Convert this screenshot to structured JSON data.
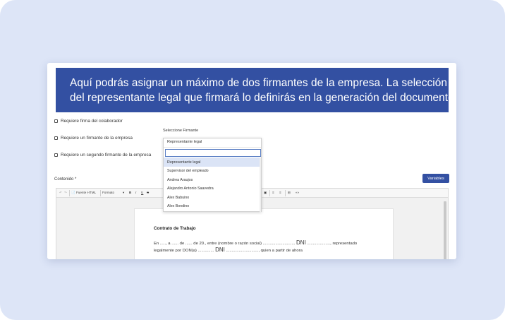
{
  "banner": {
    "line1": "Aquí podrás asignar un máximo de dos firmantes de la empresa. La selección",
    "line2": "del representante legal que firmará lo definirás en la generación del documento."
  },
  "checkboxes": [
    {
      "label": "Requiere firma del colaborador"
    },
    {
      "label": "Requiere un firmante de la empresa"
    },
    {
      "label": "Requiere un segundo firmante de la empresa"
    }
  ],
  "select_firmante": {
    "label": "Seleccione Firmante",
    "selected": "Representante legal",
    "search_value": "",
    "options": [
      "Representante legal",
      "Supervisor del empleado",
      "Andrea Araujos",
      "Alejandro Antonio Saavedra",
      "Alex Babuino",
      "Alex Bondino"
    ]
  },
  "editor": {
    "label": "Contenido *",
    "variables_button": "Variables",
    "toolbar": {
      "source": "Fuente HTML",
      "format": "Formato",
      "bold": "B",
      "italic": "I",
      "underline": "U",
      "strike": "S"
    },
    "document": {
      "title": "Contrato de Trabajo",
      "line1_a": "En ....., a ...... de ...... de 20., entre (nombre o razón social) ............................",
      "dni1": "DNI",
      "line1_b": "...................., representado",
      "line2_a": "legalmente por DON(a) ..............",
      "dni2": "DNI",
      "line2_b": "............................, quien a partir de ahora"
    }
  },
  "colors": {
    "accent": "#3350a2",
    "background": "#dde5f7"
  }
}
